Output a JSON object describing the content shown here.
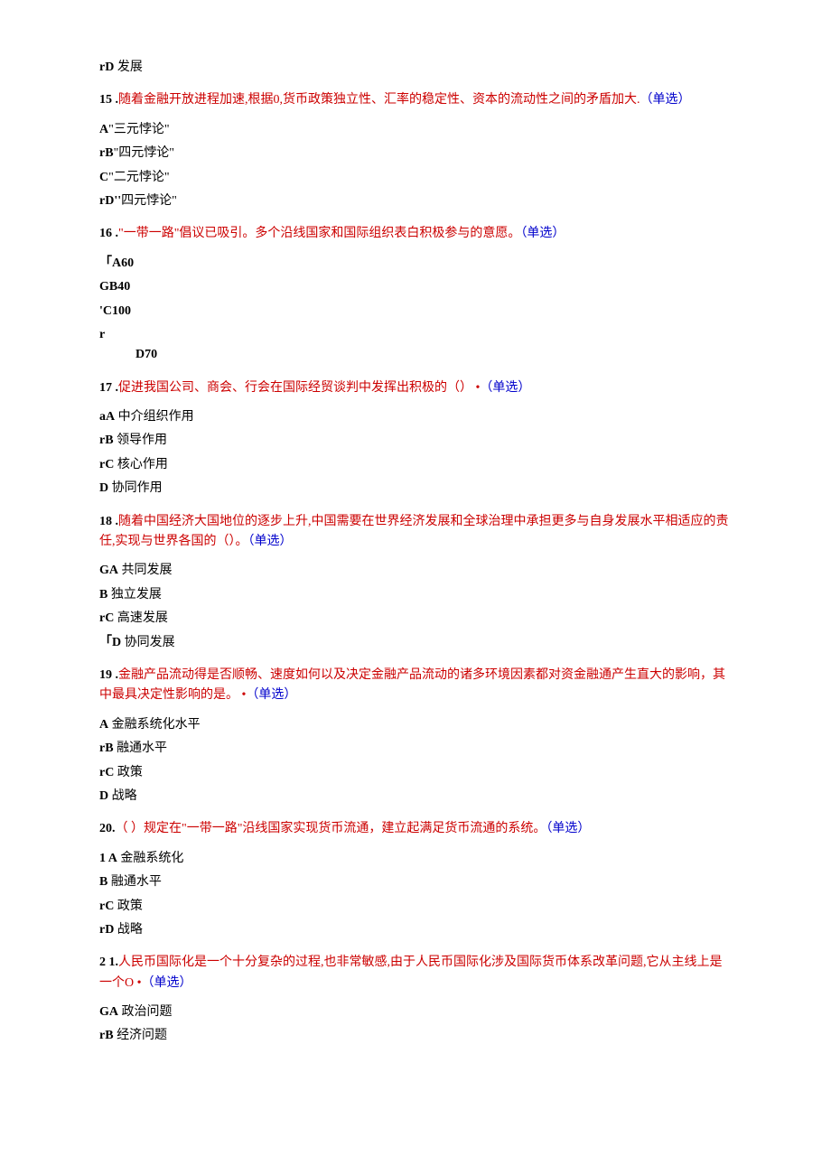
{
  "items": [
    {
      "type": "opt",
      "prefixBold": true,
      "prefix": "rD",
      "text": " 发展"
    },
    {
      "type": "q",
      "numBold": true,
      "num": "15",
      "sepBold": true,
      "sep": " .",
      "seg1Red": true,
      "seg1": "随着金融开放进程加速,根据0,货币政策独立性、汇率的稳定性、资本的流动性之间的矛盾加大.",
      "seg2Blue": true,
      "seg2": "（单选）"
    },
    {
      "type": "opt",
      "indent": 1,
      "prefixBold": true,
      "prefix": "A",
      "text": "\"三元悖论\""
    },
    {
      "type": "opt",
      "prefixBold": true,
      "prefix": "rB",
      "text": "\"四元悖论\""
    },
    {
      "type": "opt",
      "indent": 1,
      "prefixBold": true,
      "prefix": "C",
      "text": "\"二元悖论\""
    },
    {
      "type": "opt",
      "prefixBold": true,
      "prefix": "rD''",
      "text": "四元悖论\""
    },
    {
      "type": "q",
      "numBold": true,
      "num": "16",
      "sepBold": true,
      "sep": " .",
      "seg1Red": true,
      "seg1": "\"一带一路\"倡议已吸引。多个沿线国家和国际组织表白积极参与的意愿。",
      "seg2Blue": true,
      "seg2": "（单选）"
    },
    {
      "type": "opt",
      "prefixBold": true,
      "prefix": "「A",
      "textBold": true,
      "text": "60"
    },
    {
      "type": "opt",
      "prefixBold": true,
      "prefix": "GB",
      "textBold": true,
      "text": "40"
    },
    {
      "type": "opt",
      "prefixBold": true,
      "prefix": "'C",
      "textBold": true,
      "text": "100"
    },
    {
      "type": "two",
      "line1Bold": true,
      "line1": "r",
      "line2Indent": 1,
      "line2Bold": true,
      "line2": "D70"
    },
    {
      "type": "q",
      "numBold": true,
      "num": "17",
      "sepBold": true,
      "sep": " .",
      "seg1Red": true,
      "seg1": "促进我国公司、商会、行会在国际经贸谈判中发挥出积极的（） •",
      "seg2Blue": true,
      "seg2": "（单选）"
    },
    {
      "type": "opt",
      "prefixBold": true,
      "prefix": "aA",
      "text": " 中介组织作用"
    },
    {
      "type": "opt",
      "prefixBold": true,
      "prefix": "rB",
      "text": " 领导作用"
    },
    {
      "type": "opt",
      "prefixBold": true,
      "prefix": "rC",
      "text": " 核心作用"
    },
    {
      "type": "opt",
      "indent": 1,
      "prefixBold": true,
      "prefix": "D",
      "text": " 协同作用"
    },
    {
      "type": "q",
      "numBold": true,
      "num": "18",
      "sepBold": true,
      "sep": " .",
      "seg1Red": true,
      "seg1": "随着中国经济大国地位的逐步上升,中国需要在世界经济发展和全球治理中承担更多与自身发展水平相适应的责任,实现与世界各国的（）。",
      "seg2Blue": true,
      "seg2": "（单选）"
    },
    {
      "type": "opt",
      "prefixBold": true,
      "prefix": "GA",
      "text": " 共同发展"
    },
    {
      "type": "opt",
      "indent": 1,
      "prefixBold": true,
      "prefix": "B",
      "text": " 独立发展"
    },
    {
      "type": "opt",
      "prefixBold": true,
      "prefix": "rC",
      "text": " 高速发展"
    },
    {
      "type": "opt",
      "prefixBold": true,
      "prefix": "「D",
      "text": " 协同发展"
    },
    {
      "type": "q",
      "numBold": true,
      "num": "19",
      "sepBold": true,
      "sep": " .",
      "seg1Red": true,
      "seg1": "金融产品流动得是否顺畅、速度如何以及决定金融产品流动的诸多环境因素都对资金融通产生直大的影响，其中最具决定性影响的是。 •",
      "seg2Blue": true,
      "seg2": "（单选）"
    },
    {
      "type": "opt",
      "indent": 1,
      "prefixBold": true,
      "prefix": "A",
      "text": " 金融系统化水平"
    },
    {
      "type": "opt",
      "prefixBold": true,
      "prefix": "rB",
      "text": " 融通水平"
    },
    {
      "type": "opt",
      "prefixBold": true,
      "prefix": "rC",
      "text": " 政策"
    },
    {
      "type": "opt",
      "indent": 1,
      "prefixBold": true,
      "prefix": "D",
      "text": " 战略"
    },
    {
      "type": "q",
      "numBold": true,
      "num": "20.",
      "sep": "",
      "seg1Red": true,
      "seg1": "（ ）规定在\"一带一路\"沿线国家实现货币流通，建立起满足货币流通的系统。",
      "seg2Blue": true,
      "seg2": "（单选）"
    },
    {
      "type": "opt",
      "prefixBold": true,
      "prefix": "1   A",
      "text": " 金融系统化"
    },
    {
      "type": "opt",
      "indent": 1,
      "prefixBold": true,
      "prefix": "B",
      "text": " 融通水平"
    },
    {
      "type": "opt",
      "prefixBold": true,
      "prefix": "rC",
      "text": " 政策"
    },
    {
      "type": "opt",
      "prefixBold": true,
      "prefix": "rD",
      "text": " 战略"
    },
    {
      "type": "q",
      "numBold": true,
      "num": "2   1.",
      "sep": "",
      "seg1Red": true,
      "seg1": "人民币国际化是一个十分复杂的过程,也非常敏感,由于人民币国际化涉及国际货币体系改革问题,它从主线上是一个O •",
      "seg2Blue": true,
      "seg2": "（单选）"
    },
    {
      "type": "opt",
      "prefixBold": true,
      "prefix": "GA",
      "text": " 政治问题"
    },
    {
      "type": "opt",
      "prefixBold": true,
      "prefix": "rB",
      "text": " 经济问题"
    }
  ]
}
